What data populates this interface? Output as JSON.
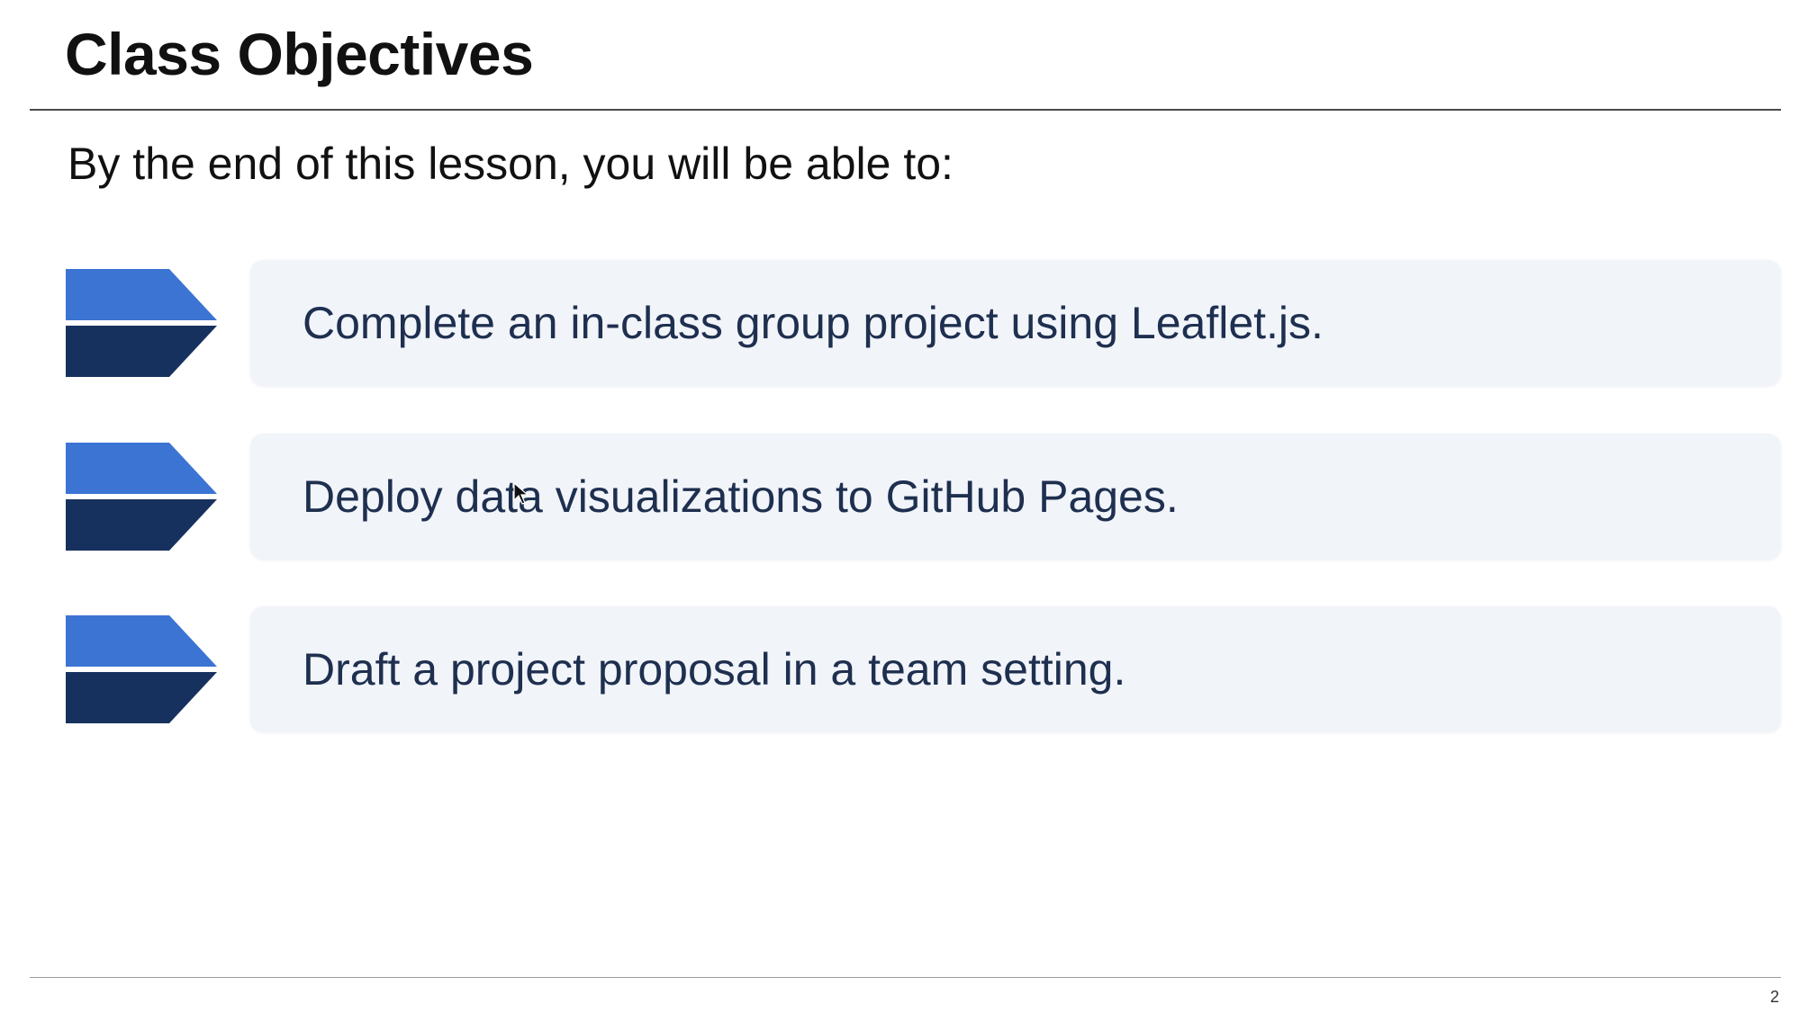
{
  "slide": {
    "title": "Class Objectives",
    "subtitle": "By the end of this lesson, you will be able to:",
    "objectives": [
      {
        "text": "Complete an in-class group project using Leaflet.js.",
        "icon": "chevron-arrow-icon"
      },
      {
        "text": "Deploy data visualizations to GitHub Pages.",
        "icon": "chevron-arrow-icon"
      },
      {
        "text": "Draft a project proposal in a team setting.",
        "icon": "chevron-arrow-icon"
      }
    ],
    "page_number": "2"
  },
  "colors": {
    "chevron_top": "#3b74d3",
    "chevron_bottom": "#17315f",
    "card_background": "#f1f4f9",
    "objective_text": "#1e2f4f",
    "title_text": "#111111"
  }
}
